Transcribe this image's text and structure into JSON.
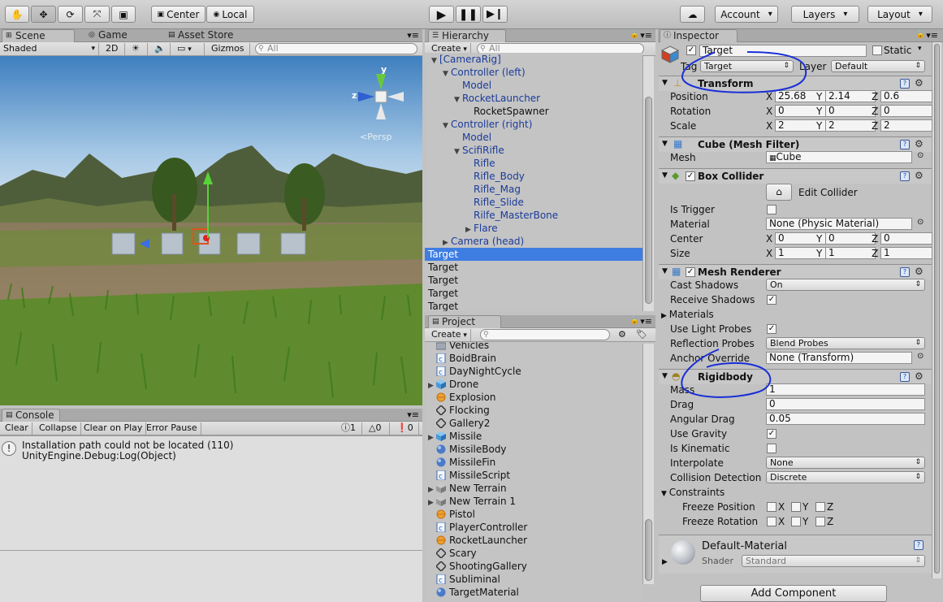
{
  "toolbar": {
    "center": "Center",
    "local": "Local",
    "account": "Account",
    "layers": "Layers",
    "layout": "Layout"
  },
  "scene": {
    "tabs": [
      "Scene",
      "Game",
      "Asset Store"
    ],
    "shading": "Shaded",
    "mode2d": "2D",
    "gizmos": "Gizmos",
    "search_placeholder": "All",
    "persp": "Persp",
    "axis_x": "z",
    "axis_y": "y"
  },
  "console": {
    "tab": "Console",
    "buttons": [
      "Clear",
      "Collapse",
      "Clear on Play",
      "Error Pause"
    ],
    "counts": [
      "1",
      "0",
      "0"
    ],
    "message_line1": "Installation path could not be located (110)",
    "message_line2": "UnityEngine.Debug:Log(Object)"
  },
  "hierarchy": {
    "tab": "Hierarchy",
    "create": "Create",
    "search_placeholder": "All",
    "items": [
      {
        "label": "[CameraRig]",
        "indent": 1,
        "arrow": "▼"
      },
      {
        "label": "Controller (left)",
        "indent": 2,
        "arrow": "▼"
      },
      {
        "label": "Model",
        "indent": 3,
        "arrow": ""
      },
      {
        "label": "RocketLauncher",
        "indent": 3,
        "arrow": "▼"
      },
      {
        "label": "RocketSpawner",
        "indent": 4,
        "arrow": "",
        "black": true
      },
      {
        "label": "Controller (right)",
        "indent": 2,
        "arrow": "▼"
      },
      {
        "label": "Model",
        "indent": 3,
        "arrow": ""
      },
      {
        "label": "ScifiRifle",
        "indent": 3,
        "arrow": "▼"
      },
      {
        "label": "Rifle",
        "indent": 4,
        "arrow": ""
      },
      {
        "label": "Rifle_Body",
        "indent": 4,
        "arrow": ""
      },
      {
        "label": "Rifle_Mag",
        "indent": 4,
        "arrow": ""
      },
      {
        "label": "Rifle_Slide",
        "indent": 4,
        "arrow": ""
      },
      {
        "label": "Rilfe_MasterBone",
        "indent": 4,
        "arrow": ""
      },
      {
        "label": "Flare",
        "indent": 4,
        "arrow": "▶"
      },
      {
        "label": "Camera (head)",
        "indent": 2,
        "arrow": "▶"
      },
      {
        "label": "Target",
        "indent": 0,
        "arrow": "",
        "selected": true
      },
      {
        "label": "Target",
        "indent": 0,
        "arrow": "",
        "black": true
      },
      {
        "label": "Target",
        "indent": 0,
        "arrow": "",
        "black": true
      },
      {
        "label": "Target",
        "indent": 0,
        "arrow": "",
        "black": true
      },
      {
        "label": "Target",
        "indent": 0,
        "arrow": "",
        "black": true
      }
    ]
  },
  "project": {
    "tab": "Project",
    "create": "Create",
    "items": [
      {
        "label": "Vehicles",
        "icon": "folder",
        "arrow": ""
      },
      {
        "label": "BoidBrain",
        "icon": "script",
        "arrow": ""
      },
      {
        "label": "DayNightCycle",
        "icon": "script",
        "arrow": ""
      },
      {
        "label": "Drone",
        "icon": "prefab",
        "arrow": "▶"
      },
      {
        "label": "Explosion",
        "icon": "particle",
        "arrow": ""
      },
      {
        "label": "Flocking",
        "icon": "unity",
        "arrow": ""
      },
      {
        "label": "Gallery2",
        "icon": "unity",
        "arrow": ""
      },
      {
        "label": "Missile",
        "icon": "prefab",
        "arrow": "▶"
      },
      {
        "label": "MissileBody",
        "icon": "material",
        "arrow": ""
      },
      {
        "label": "MissileFin",
        "icon": "material",
        "arrow": ""
      },
      {
        "label": "MissileScript",
        "icon": "script",
        "arrow": ""
      },
      {
        "label": "New Terrain",
        "icon": "terrain",
        "arrow": "▶"
      },
      {
        "label": "New Terrain 1",
        "icon": "terrain",
        "arrow": "▶"
      },
      {
        "label": "Pistol",
        "icon": "particle",
        "arrow": ""
      },
      {
        "label": "PlayerController",
        "icon": "script",
        "arrow": ""
      },
      {
        "label": "RocketLauncher",
        "icon": "particle",
        "arrow": ""
      },
      {
        "label": "Scary",
        "icon": "unity",
        "arrow": ""
      },
      {
        "label": "ShootingGallery",
        "icon": "unity",
        "arrow": ""
      },
      {
        "label": "Subliminal",
        "icon": "script",
        "arrow": ""
      },
      {
        "label": "TargetMaterial",
        "icon": "material",
        "arrow": ""
      }
    ]
  },
  "inspector": {
    "tab": "Inspector",
    "name": "Target",
    "static": "Static",
    "tag_label": "Tag",
    "tag_value": "Target",
    "layer_label": "Layer",
    "layer_value": "Default",
    "transform": {
      "title": "Transform",
      "position_label": "Position",
      "rotation_label": "Rotation",
      "scale_label": "Scale",
      "position": [
        "25.68",
        "2.14",
        "0.6"
      ],
      "rotation": [
        "0",
        "0",
        "0"
      ],
      "scale": [
        "2",
        "2",
        "2"
      ]
    },
    "mesh_filter": {
      "title": "Cube (Mesh Filter)",
      "mesh_label": "Mesh",
      "mesh_value": "Cube"
    },
    "box_collider": {
      "title": "Box Collider",
      "edit": "Edit Collider",
      "is_trigger": "Is Trigger",
      "material_label": "Material",
      "material_value": "None (Physic Material)",
      "center_label": "Center",
      "size_label": "Size",
      "center": [
        "0",
        "0",
        "0"
      ],
      "size": [
        "1",
        "1",
        "1"
      ]
    },
    "mesh_renderer": {
      "title": "Mesh Renderer",
      "cast_shadows": "Cast Shadows",
      "cast_shadows_value": "On",
      "receive_shadows": "Receive Shadows",
      "materials": "Materials",
      "use_light_probes": "Use Light Probes",
      "reflection_probes": "Reflection Probes",
      "reflection_probes_value": "Blend Probes",
      "anchor_override": "Anchor Override",
      "anchor_override_value": "None (Transform)"
    },
    "rigidbody": {
      "title": "Rigidbody",
      "mass_label": "Mass",
      "mass": "1",
      "drag_label": "Drag",
      "drag": "0",
      "angular_drag_label": "Angular Drag",
      "angular_drag": "0.05",
      "use_gravity": "Use Gravity",
      "is_kinematic": "Is Kinematic",
      "interpolate": "Interpolate",
      "interpolate_value": "None",
      "collision_detection": "Collision Detection",
      "collision_detection_value": "Discrete",
      "constraints": "Constraints",
      "freeze_position": "Freeze Position",
      "freeze_rotation": "Freeze Rotation"
    },
    "material": {
      "name": "Default-Material",
      "shader_label": "Shader",
      "shader_value": "Standard"
    },
    "add_component": "Add Component",
    "axis": [
      "X",
      "Y",
      "Z"
    ]
  },
  "colors": {
    "selection": "#3e7de2",
    "link": "#1a3b9a",
    "annotation": "#1a2fd6"
  }
}
